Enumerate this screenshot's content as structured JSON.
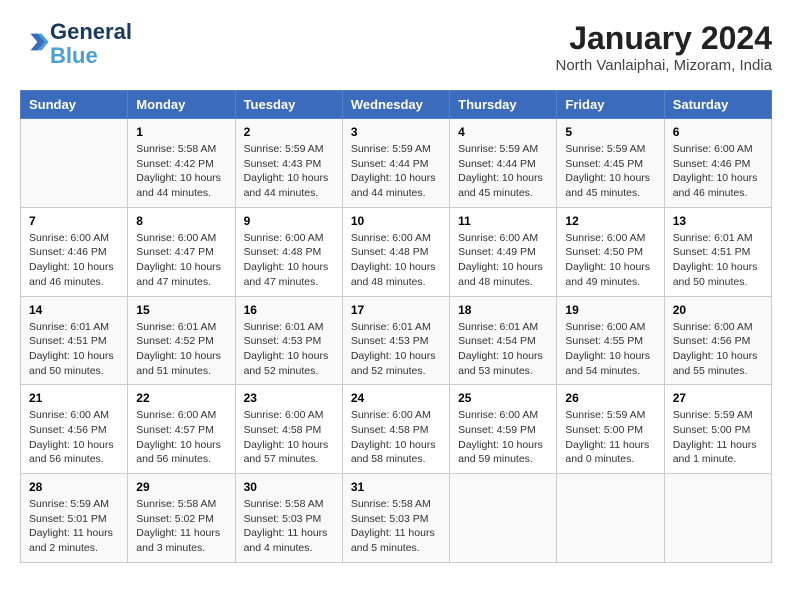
{
  "header": {
    "logo_line1": "General",
    "logo_line2": "Blue",
    "title": "January 2024",
    "subtitle": "North Vanlaiphai, Mizoram, India"
  },
  "columns": [
    "Sunday",
    "Monday",
    "Tuesday",
    "Wednesday",
    "Thursday",
    "Friday",
    "Saturday"
  ],
  "weeks": [
    [
      {
        "num": "",
        "info": ""
      },
      {
        "num": "1",
        "info": "Sunrise: 5:58 AM\nSunset: 4:42 PM\nDaylight: 10 hours\nand 44 minutes."
      },
      {
        "num": "2",
        "info": "Sunrise: 5:59 AM\nSunset: 4:43 PM\nDaylight: 10 hours\nand 44 minutes."
      },
      {
        "num": "3",
        "info": "Sunrise: 5:59 AM\nSunset: 4:44 PM\nDaylight: 10 hours\nand 44 minutes."
      },
      {
        "num": "4",
        "info": "Sunrise: 5:59 AM\nSunset: 4:44 PM\nDaylight: 10 hours\nand 45 minutes."
      },
      {
        "num": "5",
        "info": "Sunrise: 5:59 AM\nSunset: 4:45 PM\nDaylight: 10 hours\nand 45 minutes."
      },
      {
        "num": "6",
        "info": "Sunrise: 6:00 AM\nSunset: 4:46 PM\nDaylight: 10 hours\nand 46 minutes."
      }
    ],
    [
      {
        "num": "7",
        "info": "Sunrise: 6:00 AM\nSunset: 4:46 PM\nDaylight: 10 hours\nand 46 minutes."
      },
      {
        "num": "8",
        "info": "Sunrise: 6:00 AM\nSunset: 4:47 PM\nDaylight: 10 hours\nand 47 minutes."
      },
      {
        "num": "9",
        "info": "Sunrise: 6:00 AM\nSunset: 4:48 PM\nDaylight: 10 hours\nand 47 minutes."
      },
      {
        "num": "10",
        "info": "Sunrise: 6:00 AM\nSunset: 4:48 PM\nDaylight: 10 hours\nand 48 minutes."
      },
      {
        "num": "11",
        "info": "Sunrise: 6:00 AM\nSunset: 4:49 PM\nDaylight: 10 hours\nand 48 minutes."
      },
      {
        "num": "12",
        "info": "Sunrise: 6:00 AM\nSunset: 4:50 PM\nDaylight: 10 hours\nand 49 minutes."
      },
      {
        "num": "13",
        "info": "Sunrise: 6:01 AM\nSunset: 4:51 PM\nDaylight: 10 hours\nand 50 minutes."
      }
    ],
    [
      {
        "num": "14",
        "info": "Sunrise: 6:01 AM\nSunset: 4:51 PM\nDaylight: 10 hours\nand 50 minutes."
      },
      {
        "num": "15",
        "info": "Sunrise: 6:01 AM\nSunset: 4:52 PM\nDaylight: 10 hours\nand 51 minutes."
      },
      {
        "num": "16",
        "info": "Sunrise: 6:01 AM\nSunset: 4:53 PM\nDaylight: 10 hours\nand 52 minutes."
      },
      {
        "num": "17",
        "info": "Sunrise: 6:01 AM\nSunset: 4:53 PM\nDaylight: 10 hours\nand 52 minutes."
      },
      {
        "num": "18",
        "info": "Sunrise: 6:01 AM\nSunset: 4:54 PM\nDaylight: 10 hours\nand 53 minutes."
      },
      {
        "num": "19",
        "info": "Sunrise: 6:00 AM\nSunset: 4:55 PM\nDaylight: 10 hours\nand 54 minutes."
      },
      {
        "num": "20",
        "info": "Sunrise: 6:00 AM\nSunset: 4:56 PM\nDaylight: 10 hours\nand 55 minutes."
      }
    ],
    [
      {
        "num": "21",
        "info": "Sunrise: 6:00 AM\nSunset: 4:56 PM\nDaylight: 10 hours\nand 56 minutes."
      },
      {
        "num": "22",
        "info": "Sunrise: 6:00 AM\nSunset: 4:57 PM\nDaylight: 10 hours\nand 56 minutes."
      },
      {
        "num": "23",
        "info": "Sunrise: 6:00 AM\nSunset: 4:58 PM\nDaylight: 10 hours\nand 57 minutes."
      },
      {
        "num": "24",
        "info": "Sunrise: 6:00 AM\nSunset: 4:58 PM\nDaylight: 10 hours\nand 58 minutes."
      },
      {
        "num": "25",
        "info": "Sunrise: 6:00 AM\nSunset: 4:59 PM\nDaylight: 10 hours\nand 59 minutes."
      },
      {
        "num": "26",
        "info": "Sunrise: 5:59 AM\nSunset: 5:00 PM\nDaylight: 11 hours\nand 0 minutes."
      },
      {
        "num": "27",
        "info": "Sunrise: 5:59 AM\nSunset: 5:00 PM\nDaylight: 11 hours\nand 1 minute."
      }
    ],
    [
      {
        "num": "28",
        "info": "Sunrise: 5:59 AM\nSunset: 5:01 PM\nDaylight: 11 hours\nand 2 minutes."
      },
      {
        "num": "29",
        "info": "Sunrise: 5:58 AM\nSunset: 5:02 PM\nDaylight: 11 hours\nand 3 minutes."
      },
      {
        "num": "30",
        "info": "Sunrise: 5:58 AM\nSunset: 5:03 PM\nDaylight: 11 hours\nand 4 minutes."
      },
      {
        "num": "31",
        "info": "Sunrise: 5:58 AM\nSunset: 5:03 PM\nDaylight: 11 hours\nand 5 minutes."
      },
      {
        "num": "",
        "info": ""
      },
      {
        "num": "",
        "info": ""
      },
      {
        "num": "",
        "info": ""
      }
    ]
  ]
}
